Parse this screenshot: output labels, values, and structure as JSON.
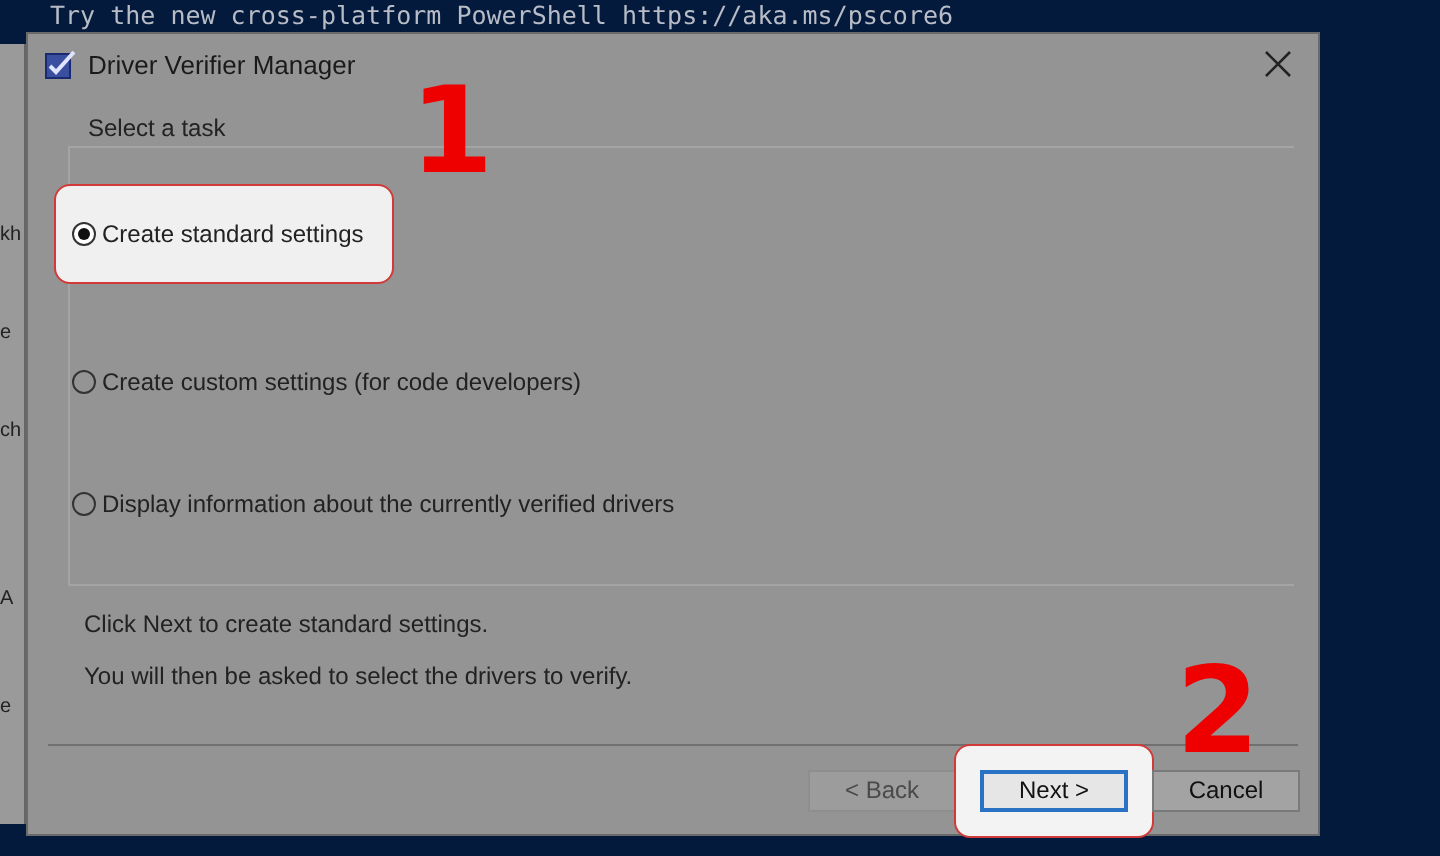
{
  "console": {
    "text": "Try the new cross-platform PowerShell https://aka.ms/pscore6"
  },
  "background_window": {
    "fragments": [
      "kh",
      "e",
      "ch",
      "A",
      "e"
    ]
  },
  "dialog": {
    "title": "Driver Verifier Manager",
    "group_label": "Select a task",
    "options": [
      {
        "label": "Create standard settings",
        "selected": true,
        "highlighted": true
      },
      {
        "label": "Create custom settings (for code developers)",
        "selected": false,
        "highlighted": false
      },
      {
        "label": "Display information about the currently verified drivers",
        "selected": false,
        "highlighted": false
      }
    ],
    "info": [
      "Click Next to create standard settings.",
      "You will then be asked to select the drivers to verify."
    ],
    "buttons": [
      {
        "label": "< Back",
        "disabled": true,
        "default": false,
        "highlighted": false
      },
      {
        "label": "Next >",
        "disabled": false,
        "default": true,
        "highlighted": true
      },
      {
        "label": "Cancel",
        "disabled": false,
        "default": false,
        "highlighted": false
      }
    ]
  },
  "annotations": [
    {
      "text": "1"
    },
    {
      "text": "2"
    }
  ]
}
